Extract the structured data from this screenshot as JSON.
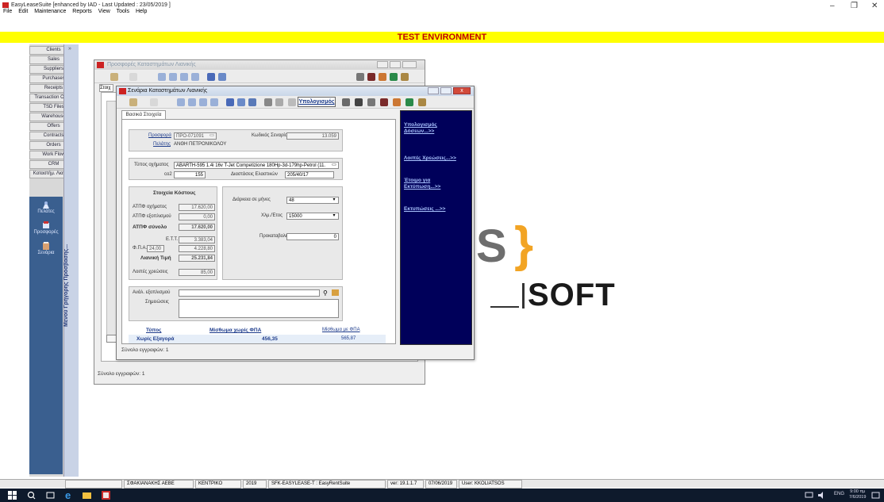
{
  "app": {
    "title": "EasyLeaseSuite [enhanced by IAD - Last Updated : 23/05/2019 ]",
    "menu": [
      "File",
      "Edit",
      "Maintenance",
      "Reports",
      "View",
      "Tools",
      "Help"
    ],
    "environment_banner": "TEST ENVIRONMENT"
  },
  "sidebar": {
    "items": [
      "Clients",
      "Sales",
      "Suppliers",
      "Purchases",
      "Receipts",
      "Transaction Office",
      "TSD Files",
      "Warehouse",
      "Offers",
      "Contracts",
      "Orders",
      "Work Flow",
      "CRM",
      "Καταστήμ. Λιανικής"
    ],
    "shortcuts": [
      "Πελάτες",
      "Προσφορές",
      "Σενάρια"
    ],
    "quick_menu_label": "Μενού Γρήγορης Πρόσβασης..."
  },
  "back_window": {
    "title": "Προσφορές Καταστημάτων Λιανικής",
    "status": "Σύνολο εγγραφών: 1"
  },
  "front_window": {
    "title": "Σενάρια Καταστημάτων Λιανικής",
    "calc_button": "Υπολογισμός",
    "tab": "Βασικά Στοιχεία",
    "status": "Σύνολο εγγραφών: 1",
    "offer_label": "Προσφορά",
    "offer_value": "ΠΡΟ-071091",
    "scenario_code_label": "Κωδικός Σεναρίου",
    "scenario_code_value": "13.059",
    "client_label": "Πελάτης",
    "client_value": "ΑΝΘΗ ΠΕΤΡΟΝΙΚΟΛΟΥ",
    "vehicle_type_label": "Τύπος οχήματος",
    "vehicle_type_value": "ABARTH-595 1.4i 16v T-Jet Competizione 180Hp-3d-179hp-Petrol (11.",
    "co2_label": "co2",
    "co2_value": "155",
    "tire_label": "Διαστάσεις Ελαστικών",
    "tire_value": "205/40/17",
    "cost_header": "Στοιχεία Κόστους",
    "vehicle_price_label": "ΑΤΠΦ οχήματος",
    "vehicle_price_value": "17.620,00",
    "equipment_label": "ΑΤΠΦ εξοπλισμού",
    "equipment_value": "0,00",
    "total_label": "ΑΤΠΦ σύνολο",
    "total_value": "17.620,00",
    "ett_label": "Ε.Τ.Τ.",
    "ett_value": "3.383,04",
    "vat_label": "Φ.Π.Α.",
    "vat_rate": "24,00",
    "vat_value": "4.228,80",
    "retail_label": "Λιανική Τιμή",
    "retail_value": "25.231,84",
    "other_costs_label": "Λοιπές χρεώσεις",
    "other_costs_value": "85,00",
    "duration_label": "Διάρκεια σε μήνες",
    "duration_value": "48",
    "km_label": "Χλμ./Έτος",
    "km_value": "15000",
    "advance_label": "Προκαταβολή",
    "advance_value": "0",
    "equipment_desc_label": "Ανάλ. εξοπλισμού",
    "notes_label": "Σημειώσεις",
    "summary_headers": [
      "Τύπος",
      "Μίσθωμα χωρίς ΦΠΑ",
      "Μίσθωμα με ΦΠΑ"
    ],
    "summary_row": [
      "Χωρίς Εξαγορά",
      "456,35",
      "565,87"
    ],
    "side_links": [
      "Υπολογισμός Δόσεων...>>",
      "Λοιπές Χρεώσεις...>>",
      "Έτοιμο για Εκτύπωση...>>",
      "Εκτυπώσεις ...>>"
    ]
  },
  "logo": {
    "mark": "S",
    "brace": "}",
    "word": "SOFT"
  },
  "statusbar": [
    "ΣΦΑΚΙΑΝΑΚΗΣ ΑΕΒΕ",
    "ΚΕΝΤΡΙΚΟ",
    "2019",
    "SFK-EASYLEASE-T : EasyRentSuite",
    "ver: 19.1.1.7",
    "07/06/2019",
    "User: KKOLIATSOS"
  ],
  "taskbar": {
    "lang": "ENG",
    "time": "9:00 πμ",
    "date": "7/6/2019"
  },
  "colors": {
    "env_bar": "#ffff00",
    "env_text": "#c00000",
    "blue_panel": "#00005a",
    "logo_orange": "#f2a424"
  }
}
